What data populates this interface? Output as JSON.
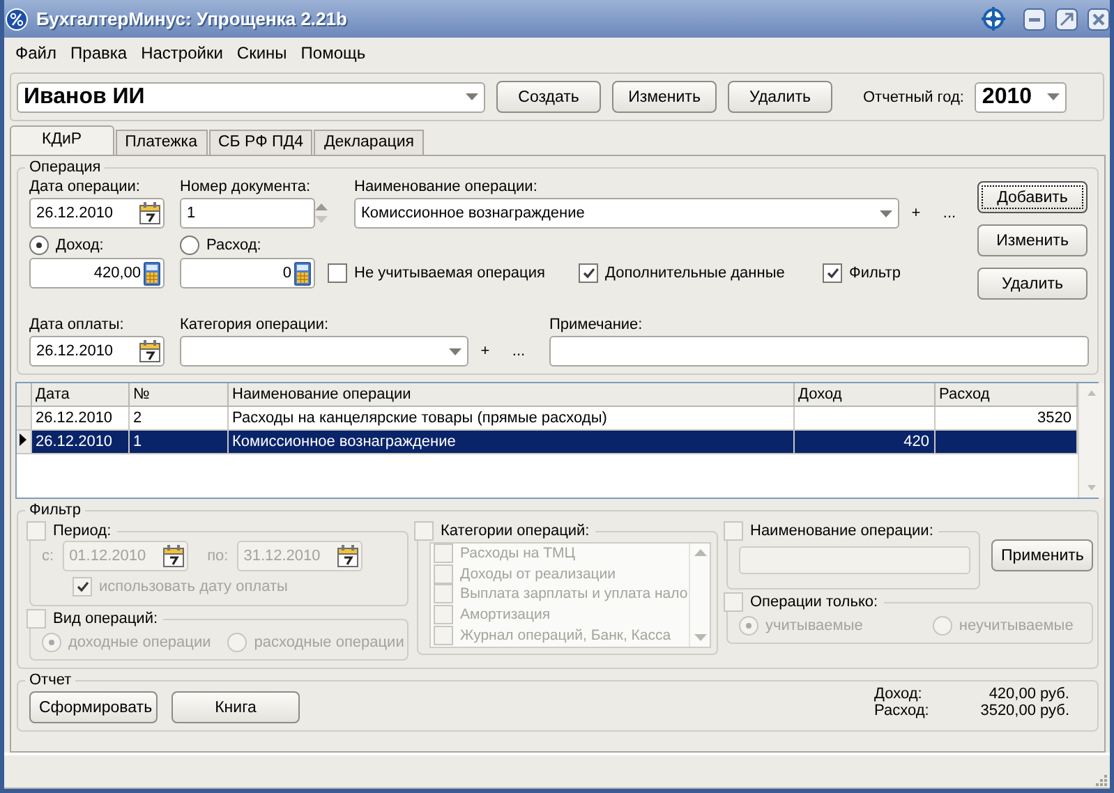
{
  "window": {
    "title": "БухгалтерМинус: Упрощенка 2.21b"
  },
  "menu": [
    "Файл",
    "Правка",
    "Настройки",
    "Скины",
    "Помощь"
  ],
  "toolbar": {
    "person": "Иванов ИИ",
    "buttons": [
      "Создать",
      "Изменить",
      "Удалить"
    ],
    "year_label": "Отчетный год:",
    "year": "2010"
  },
  "tabs": [
    {
      "label": "КДиР",
      "selected": true
    },
    {
      "label": "Платежка",
      "selected": false
    },
    {
      "label": "СБ РФ ПД4",
      "selected": false
    },
    {
      "label": "Декларация",
      "selected": false
    }
  ],
  "operation": {
    "title": "Операция",
    "date_label": "Дата операции:",
    "date": "26.12.2010",
    "doc_label": "Номер документа:",
    "doc": "1",
    "name_label": "Наименование операции:",
    "name": "Комиссионное вознаграждение",
    "name_plus": "+",
    "name_more": "...",
    "income": {
      "label": "Доход:",
      "selected": true,
      "value": "420,00"
    },
    "expense": {
      "label": "Расход:",
      "selected": false,
      "value": "0"
    },
    "checks": [
      {
        "label": "Не учитываемая операция",
        "checked": false
      },
      {
        "label": "Дополнительные данные",
        "checked": true
      },
      {
        "label": "Фильтр",
        "checked": true
      }
    ],
    "pay_date_label": "Дата оплаты:",
    "pay_date": "26.12.2010",
    "category_label": "Категория операции:",
    "category_plus": "+",
    "category_more": "...",
    "note_label": "Примечание:",
    "buttons": [
      {
        "label": "Добавить",
        "focused": true
      },
      {
        "label": "Изменить",
        "focused": false
      },
      {
        "label": "Удалить",
        "focused": false
      }
    ]
  },
  "table": {
    "columns": [
      "Дата",
      "№",
      "Наименование операции",
      "Доход",
      "Расход"
    ],
    "rows": [
      {
        "date": "26.12.2010",
        "number": "2",
        "name": "Расходы на канцелярские товары (прямые расходы)",
        "expense": "3520",
        "selected": false
      },
      {
        "date": "26.12.2010",
        "number": "1",
        "name": "Комиссионное вознаграждение",
        "income": "420",
        "selected": true
      }
    ]
  },
  "filter": {
    "title": "Фильтр",
    "period": {
      "label": "Период:",
      "checked": false,
      "from_label": "с:",
      "from": "01.12.2010",
      "to_label": "по:",
      "to": "31.12.2010",
      "use_pay_date": {
        "label": "использовать дату оплаты",
        "checked": true
      }
    },
    "kind": {
      "label": "Вид операций:",
      "checked": false,
      "options": [
        {
          "label": "доходные операции",
          "selected": true
        },
        {
          "label": "расходные операции",
          "selected": false
        }
      ]
    },
    "categories": {
      "label": "Категории операций:",
      "checked": false,
      "items": [
        {
          "label": "Расходы на ТМЦ",
          "checked": false
        },
        {
          "label": "Доходы от реализации",
          "checked": false
        },
        {
          "label": "Выплата зарплаты и уплата нало",
          "checked": false
        },
        {
          "label": "Амортизация",
          "checked": false
        },
        {
          "label": "Журнал операций, Банк, Касса",
          "checked": false
        }
      ]
    },
    "name_filter": {
      "label": "Наименование операции:",
      "checked": false
    },
    "apply": "Применить",
    "only": {
      "label": "Операции только:",
      "checked": false,
      "options": [
        {
          "label": "учитываемые",
          "selected": true
        },
        {
          "label": "неучитываемые",
          "selected": false
        }
      ]
    }
  },
  "report": {
    "title": "Отчет",
    "buttons": [
      "Сформировать",
      "Книга"
    ],
    "totals": [
      {
        "label": "Доход:",
        "value": "420,00 руб."
      },
      {
        "label": "Расход:",
        "value": "3520,00 руб."
      }
    ]
  }
}
